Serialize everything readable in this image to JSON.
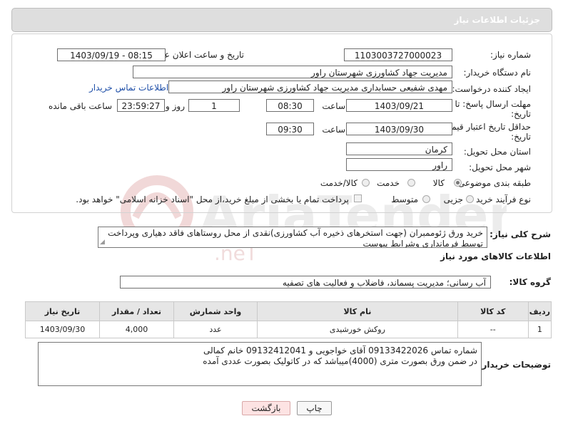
{
  "panel": {
    "title": "جزئیات اطلاعات نیاز"
  },
  "form": {
    "need_number": {
      "label": "شماره نیاز:",
      "value": "1103003727000023"
    },
    "announce": {
      "label": "تاریخ و ساعت اعلان عمومی:",
      "value": "1403/09/19 - 08:15"
    },
    "buyer_org": {
      "label": "نام دستگاه خریدار:",
      "value": "مدیریت جهاد کشاورزی شهرستان راور"
    },
    "creator": {
      "label": "ایجاد کننده درخواست:",
      "value": "مهدی شفیعی حسابداری مدیریت جهاد کشاورزی شهرستان راور",
      "contact_link": "اطلاعات تماس خریدار"
    },
    "reply_deadline": {
      "label_line1": "مهلت ارسال پاسخ: تا",
      "label_line2": "تاریخ:",
      "date": "1403/09/21",
      "time_label": "ساعت",
      "time": "08:30",
      "days": "1",
      "days_label": "روز و",
      "remaining": "23:59:27",
      "remaining_label": "ساعت باقی مانده"
    },
    "price_validity": {
      "label_line1": "حداقل تاریخ اعتبار قیمت: تا",
      "label_line2": "تاریخ:",
      "date": "1403/09/30",
      "time_label": "ساعت",
      "time": "09:30"
    },
    "province": {
      "label": "استان محل تحویل:",
      "value": "کرمان"
    },
    "city": {
      "label": "شهر محل تحویل:",
      "value": "راور"
    },
    "category": {
      "label": "طبقه بندی موضوعی:",
      "options": [
        "کالا",
        "خدمت",
        "کالا/خدمت"
      ],
      "selected": "کالا"
    },
    "purchase_type": {
      "label": "نوع فرآیند خرید :",
      "options": [
        "جزیی",
        "متوسط"
      ],
      "payment_note": "پرداخت تمام یا بخشی از مبلغ خرید،از محل \"اسناد خزانه اسلامی\" خواهد بود."
    }
  },
  "description": {
    "label": "شرح کلی نیاز:",
    "text": "خرید ورق ژئوممبران (جهت استخرهای ذخیره آب کشاورزی)نقدی از محل روستاهای فاقد دهیاری وپرداخت توسط فرمانداری وشرایط پیوست"
  },
  "goods_section": {
    "title": "اطلاعات کالاهای مورد نیاز"
  },
  "goods_group": {
    "label": "گروه کالا:",
    "value": "آب رسانی؛ مدیریت پسماند، فاضلاب و فعالیت های تصفیه"
  },
  "table": {
    "headers": [
      "ردیف",
      "کد کالا",
      "نام کالا",
      "واحد شمارش",
      "تعداد / مقدار",
      "تاریخ نیاز"
    ],
    "rows": [
      [
        "1",
        "--",
        "روکش خورشیدی",
        "عدد",
        "4,000",
        "1403/09/30"
      ]
    ]
  },
  "buyer_notes": {
    "label": "توضیحات خریدار:",
    "line1": "شماره تماس 09133422026 آقای خواجویی و 09132412041 خانم کمالی",
    "line2": "در ضمن ورق بصورت متری (4000)میباشد که در کاتولیک بصورت عددی آمده"
  },
  "buttons": {
    "print": "چاپ",
    "back": "بازگشت"
  },
  "colors": {
    "panel_bg": "#dedede",
    "link": "#1f4fa8",
    "back_button_bg": "#fde3e3"
  },
  "watermark": {
    "text": "AriaTender.net"
  }
}
